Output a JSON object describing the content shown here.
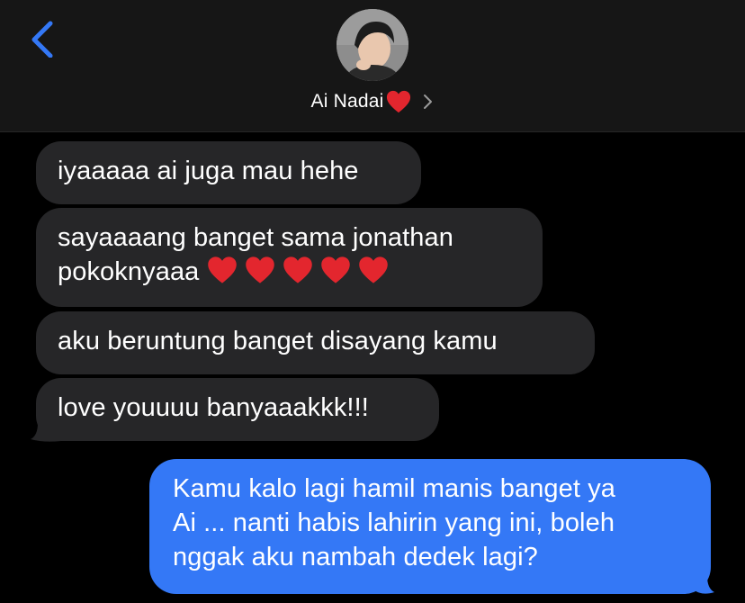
{
  "header": {
    "back_icon": "chevron-left-icon",
    "contact_name": "Ai Nadai",
    "contact_heart": "heart-icon",
    "chevron_icon": "chevron-right-icon"
  },
  "messages": [
    {
      "side": "received",
      "lines": [
        "iyaaaaa ai juga mau hehe"
      ]
    },
    {
      "side": "received",
      "lines": [
        "sayaaaang banget sama jonathan",
        "pokoknyaaa"
      ],
      "emoji_hearts": 5
    },
    {
      "side": "received",
      "lines": [
        "aku beruntung banget disayang kamu"
      ]
    },
    {
      "side": "received",
      "lines": [
        "love youuuu banyaaakkk!!!"
      ]
    },
    {
      "side": "sent",
      "lines": [
        "Kamu kalo lagi hamil manis banget ya",
        "Ai ... nanti habis lahirin yang ini, boleh",
        "nggak aku nambah dedek lagi?"
      ]
    }
  ],
  "colors": {
    "received_bubble": "#262628",
    "sent_bubble": "#3478f6",
    "accent": "#3478f6",
    "heart": "#e3262e"
  }
}
